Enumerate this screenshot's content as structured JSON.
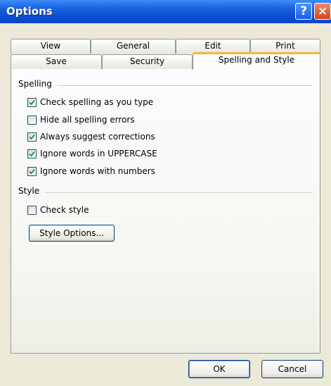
{
  "window": {
    "title": "Options",
    "help_glyph": "?",
    "close_glyph": "×"
  },
  "tabs": {
    "row_back": [
      {
        "label": "View"
      },
      {
        "label": "General"
      },
      {
        "label": "Edit"
      },
      {
        "label": "Print"
      }
    ],
    "row_front": [
      {
        "label": "Save"
      },
      {
        "label": "Security"
      },
      {
        "label": "Spelling and Style",
        "active": true
      }
    ]
  },
  "spelling": {
    "heading": "Spelling",
    "options": [
      {
        "label": "Check spelling as you type",
        "checked": true
      },
      {
        "label": "Hide all spelling errors",
        "checked": false
      },
      {
        "label": "Always suggest corrections",
        "checked": true
      },
      {
        "label": "Ignore words in UPPERCASE",
        "checked": true
      },
      {
        "label": "Ignore words with numbers",
        "checked": true
      }
    ]
  },
  "style": {
    "heading": "Style",
    "check_style": {
      "label": "Check style",
      "checked": false
    },
    "options_button": "Style Options..."
  },
  "footer": {
    "ok_label": "OK",
    "cancel_label": "Cancel"
  },
  "colors": {
    "titlebar": "#0b4fd3",
    "active_tab_accent": "#f7b53c",
    "check_mark": "#21a121"
  }
}
